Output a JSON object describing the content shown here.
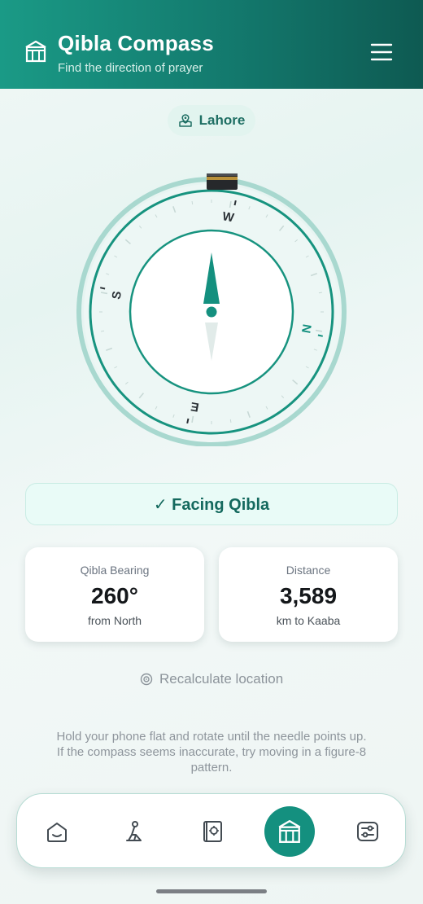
{
  "header": {
    "title": "Qibla Compass",
    "subtitle": "Find the direction of prayer",
    "logo_icon": "kaaba-icon",
    "menu_icon": "hamburger-menu-icon"
  },
  "location": {
    "city": "Lahore",
    "icon": "map-pin-icon"
  },
  "compass": {
    "cardinal_labels": {
      "north": "N",
      "east": "E",
      "south": "S",
      "west": "W"
    },
    "needle_color": "#14907f"
  },
  "status": {
    "text": "✓ Facing Qibla"
  },
  "bearing_card": {
    "label": "Qibla Bearing",
    "value": "260°",
    "sub": "from North"
  },
  "distance_card": {
    "label": "Distance",
    "value": "3,589",
    "sub": "km to Kaaba"
  },
  "recalculate": {
    "label": "Recalculate location",
    "icon": "location-target-icon"
  },
  "hint": {
    "line1": "Hold your phone flat and rotate until the needle points up.",
    "line2": "If the compass seems inaccurate, try moving in a figure-8",
    "line3": "pattern."
  },
  "nav": {
    "items": [
      "home-icon",
      "prayer-icon",
      "quran-icon",
      "qibla-icon",
      "settings-icon"
    ],
    "active": "qibla-icon"
  },
  "colors": {
    "accent": "#14907f",
    "header_dark": "#0e5a52",
    "text_dark": "#14171a"
  }
}
